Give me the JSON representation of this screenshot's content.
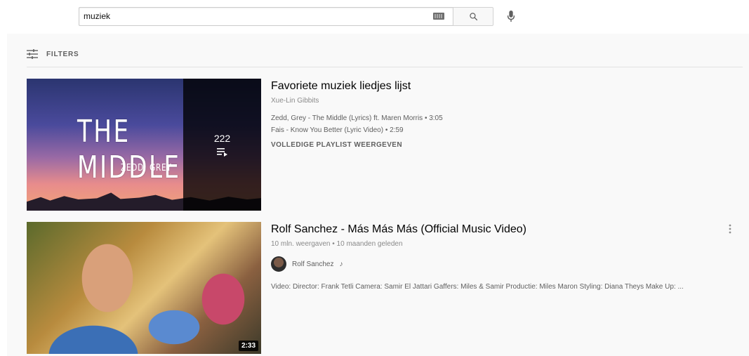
{
  "search": {
    "value": "muziek",
    "keyboard_icon": "keyboard-icon",
    "search_icon": "search-icon",
    "mic_icon": "microphone-icon"
  },
  "filters": {
    "label": "FILTERS",
    "icon": "filter-sliders-icon"
  },
  "results": [
    {
      "type": "playlist",
      "title": "Favoriete muziek liedjes lijst",
      "channel": "Xue-Lin Gibbits",
      "thumbnail_text": "THE MIDDLE",
      "thumbnail_subtext": "ZEDD, GREY",
      "video_count": "222",
      "tracks": [
        "Zedd, Grey - The Middle (Lyrics) ft. Maren Morris • 3:05",
        "Fais - Know You Better (Lyric Video) • 2:59"
      ],
      "play_all": "VOLLEDIGE PLAYLIST WEERGEVEN"
    },
    {
      "type": "video",
      "title": "Rolf Sanchez - Más Más Más (Official Music Video)",
      "meta": "10 mln. weergaven • 10 maanden geleden",
      "channel": "Rolf Sanchez",
      "channel_badge": "♪",
      "description": "Video: Director: Frank Tetli Camera: Samir El Jattari Gaffers: Miles & Samir Productie: Miles Maron Styling: Diana Theys Make Up: ...",
      "duration": "2:33"
    }
  ],
  "colors": {
    "panel_bg": "#f9f9f9",
    "text_primary": "#030303",
    "text_secondary": "#606060"
  }
}
